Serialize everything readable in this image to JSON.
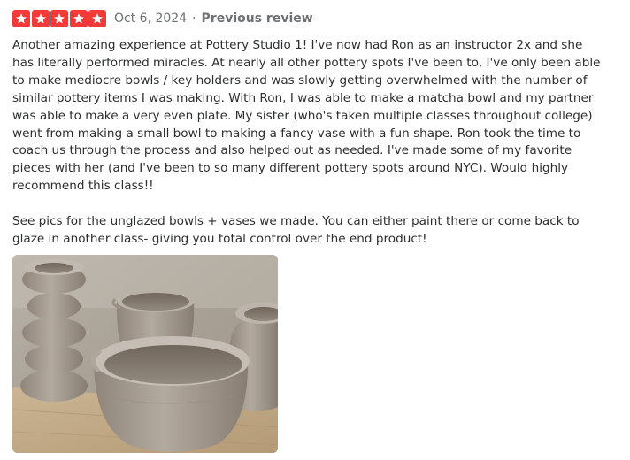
{
  "rating": {
    "stars": 5,
    "max": 5,
    "color": "#f43939",
    "icon": "star-icon"
  },
  "date": "Oct 6, 2024",
  "separator": "·",
  "previous_review_label": "Previous review",
  "review": {
    "paragraphs": [
      "Another amazing experience at Pottery Studio 1! I've now had Ron as an instructor 2x and she has literally performed miracles. At nearly all other pottery spots I've been to, I've only been able to make mediocre bowls / key holders and was slowly getting overwhelmed with the number of similar pottery items I was making. With Ron, I was able to make a matcha bowl and my partner was able to make a very even plate. My sister (who's taken multiple classes throughout college) went from making a small bowl to making a fancy vase with a fun shape. Ron took the time to coach us through the process and also helped out as needed. I've made some of my favorite pieces with her (and I've been to so many different pottery spots around NYC). Would highly recommend this class!!",
      "See pics for the unglazed bowls + vases we made. You can either paint there or come back to glaze in another class- giving you total control over the end product!"
    ]
  }
}
